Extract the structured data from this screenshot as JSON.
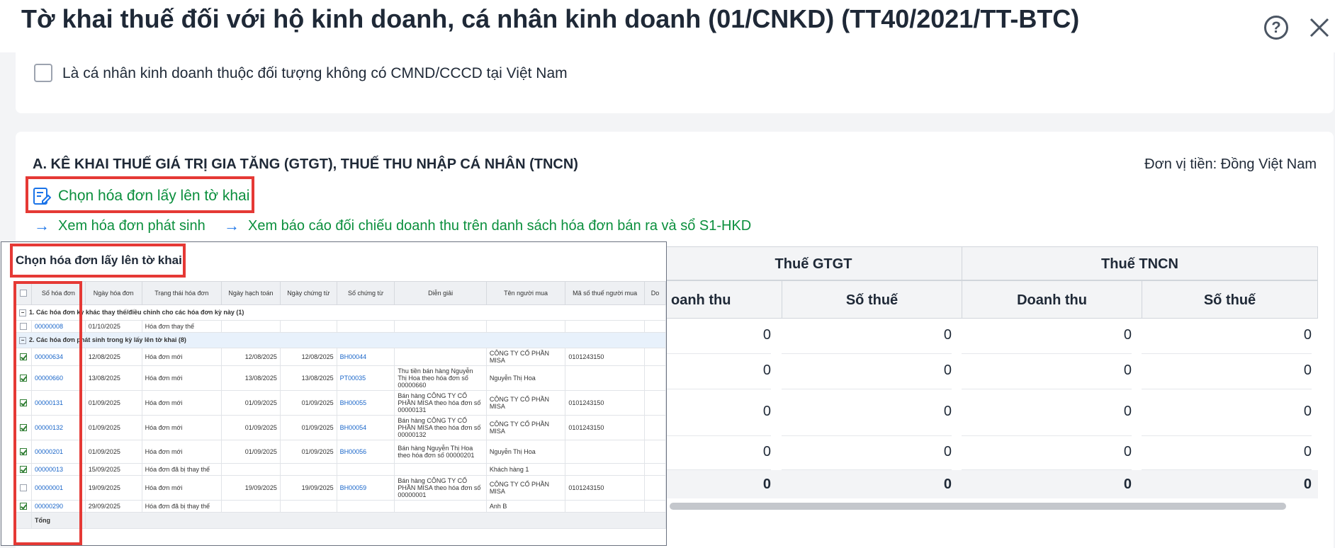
{
  "header": {
    "title": "Tờ khai thuế đối với hộ kinh doanh, cá nhân kinh doanh (01/CNKD) (TT40/2021/TT-BTC)",
    "help_glyph": "?"
  },
  "option": {
    "label": "Là cá nhân kinh doanh thuộc đối tượng không có CMND/CCCD tại Việt Nam"
  },
  "section": {
    "title": "A. KÊ KHAI THUẾ GIÁ TRỊ GIA TĂNG (GTGT), THUẾ THU NHẬP CÁ NHÂN (TNCN)",
    "unit": "Đơn vị tiền: Đồng Việt Nam",
    "choose_link": "Chọn hóa đơn lấy lên tờ khai",
    "view_link": "Xem hóa đơn phát sinh",
    "report_link": "Xem báo cáo đối chiếu doanh thu trên danh sách hóa đơn bán ra và sổ S1-HKD"
  },
  "summary": {
    "group_vat": "Thuế GTGT",
    "group_pit": "Thuế TNCN",
    "col_revenue_partial": "oanh thu",
    "col_tax": "Số thuế",
    "col_revenue": "Doanh thu",
    "rows": [
      [
        "0",
        "0",
        "0",
        "0"
      ],
      [
        "0",
        "0",
        "0",
        "0"
      ],
      [
        "0",
        "0",
        "0",
        "0"
      ],
      [
        "0",
        "0",
        "0",
        "0"
      ]
    ],
    "total": [
      "0",
      "0",
      "0",
      "0"
    ]
  },
  "popup": {
    "title": "Chọn hóa đơn lấy lên tờ khai",
    "columns": [
      "Số hóa đơn",
      "Ngày hóa đơn",
      "Trạng thái hóa đơn",
      "Ngày hạch toán",
      "Ngày chứng từ",
      "Số chứng từ",
      "Diễn giải",
      "Tên người mua",
      "Mã số thuế người mua",
      "Do"
    ],
    "group1": "1. Các hóa đơn kỳ khác thay thế/điều chỉnh cho các hóa đơn kỳ này (1)",
    "group2": "2. Các hóa đơn phát sinh trong kỳ lấy lên tờ khai (8)",
    "group1_rows": [
      {
        "checked": false,
        "no": "00000008",
        "date": "01/10/2025",
        "status": "Hóa đơn thay thế",
        "post": "",
        "doc_date": "",
        "doc_no": "",
        "desc": "",
        "buyer": "",
        "tax": ""
      }
    ],
    "group2_rows": [
      {
        "checked": true,
        "no": "00000634",
        "date": "12/08/2025",
        "status": "Hóa đơn mới",
        "post": "12/08/2025",
        "doc_date": "12/08/2025",
        "doc_no": "BH00044",
        "desc": "",
        "buyer": "CÔNG TY CỔ PHẦN MISA",
        "tax": "0101243150"
      },
      {
        "checked": true,
        "no": "00000660",
        "date": "13/08/2025",
        "status": "Hóa đơn mới",
        "post": "13/08/2025",
        "doc_date": "13/08/2025",
        "doc_no": "PT00035",
        "desc": "Thu tiền bán hàng Nguyễn Thị Hoa theo hóa đơn số 00000660",
        "buyer": "Nguyễn Thị Hoa",
        "tax": ""
      },
      {
        "checked": true,
        "no": "00000131",
        "date": "01/09/2025",
        "status": "Hóa đơn mới",
        "post": "01/09/2025",
        "doc_date": "01/09/2025",
        "doc_no": "BH00055",
        "desc": "Bán hàng CÔNG TY CỔ PHẦN MISA theo hóa đơn số 00000131",
        "buyer": "CÔNG TY CỔ PHẦN MISA",
        "tax": "0101243150"
      },
      {
        "checked": true,
        "no": "00000132",
        "date": "01/09/2025",
        "status": "Hóa đơn mới",
        "post": "01/09/2025",
        "doc_date": "01/09/2025",
        "doc_no": "BH00054",
        "desc": "Bán hàng CÔNG TY CỔ PHẦN MISA theo hóa đơn số 00000132",
        "buyer": "CÔNG TY CỔ PHẦN MISA",
        "tax": "0101243150"
      },
      {
        "checked": true,
        "no": "00000201",
        "date": "01/09/2025",
        "status": "Hóa đơn mới",
        "post": "01/09/2025",
        "doc_date": "01/09/2025",
        "doc_no": "BH00056",
        "desc": "Bán hàng Nguyễn Thị Hoa theo hóa đơn số 00000201",
        "buyer": "Nguyễn Thị Hoa",
        "tax": ""
      },
      {
        "checked": true,
        "no": "00000013",
        "date": "15/09/2025",
        "status": "Hóa đơn đã bị thay thế",
        "post": "",
        "doc_date": "",
        "doc_no": "",
        "desc": "",
        "buyer": "Khách hàng 1",
        "tax": ""
      },
      {
        "checked": false,
        "no": "00000001",
        "date": "19/09/2025",
        "status": "Hóa đơn mới",
        "post": "19/09/2025",
        "doc_date": "19/09/2025",
        "doc_no": "BH00059",
        "desc": "Bán hàng CÔNG TY CỔ PHẦN MISA theo hóa đơn số 00000001",
        "buyer": "CÔNG TY CỔ PHẦN MISA",
        "tax": "0101243150"
      },
      {
        "checked": true,
        "no": "00000290",
        "date": "29/09/2025",
        "status": "Hóa đơn đã bị thay thế",
        "post": "",
        "doc_date": "",
        "doc_no": "",
        "desc": "",
        "buyer": "Anh B",
        "tax": ""
      }
    ],
    "total_label": "Tổng"
  }
}
